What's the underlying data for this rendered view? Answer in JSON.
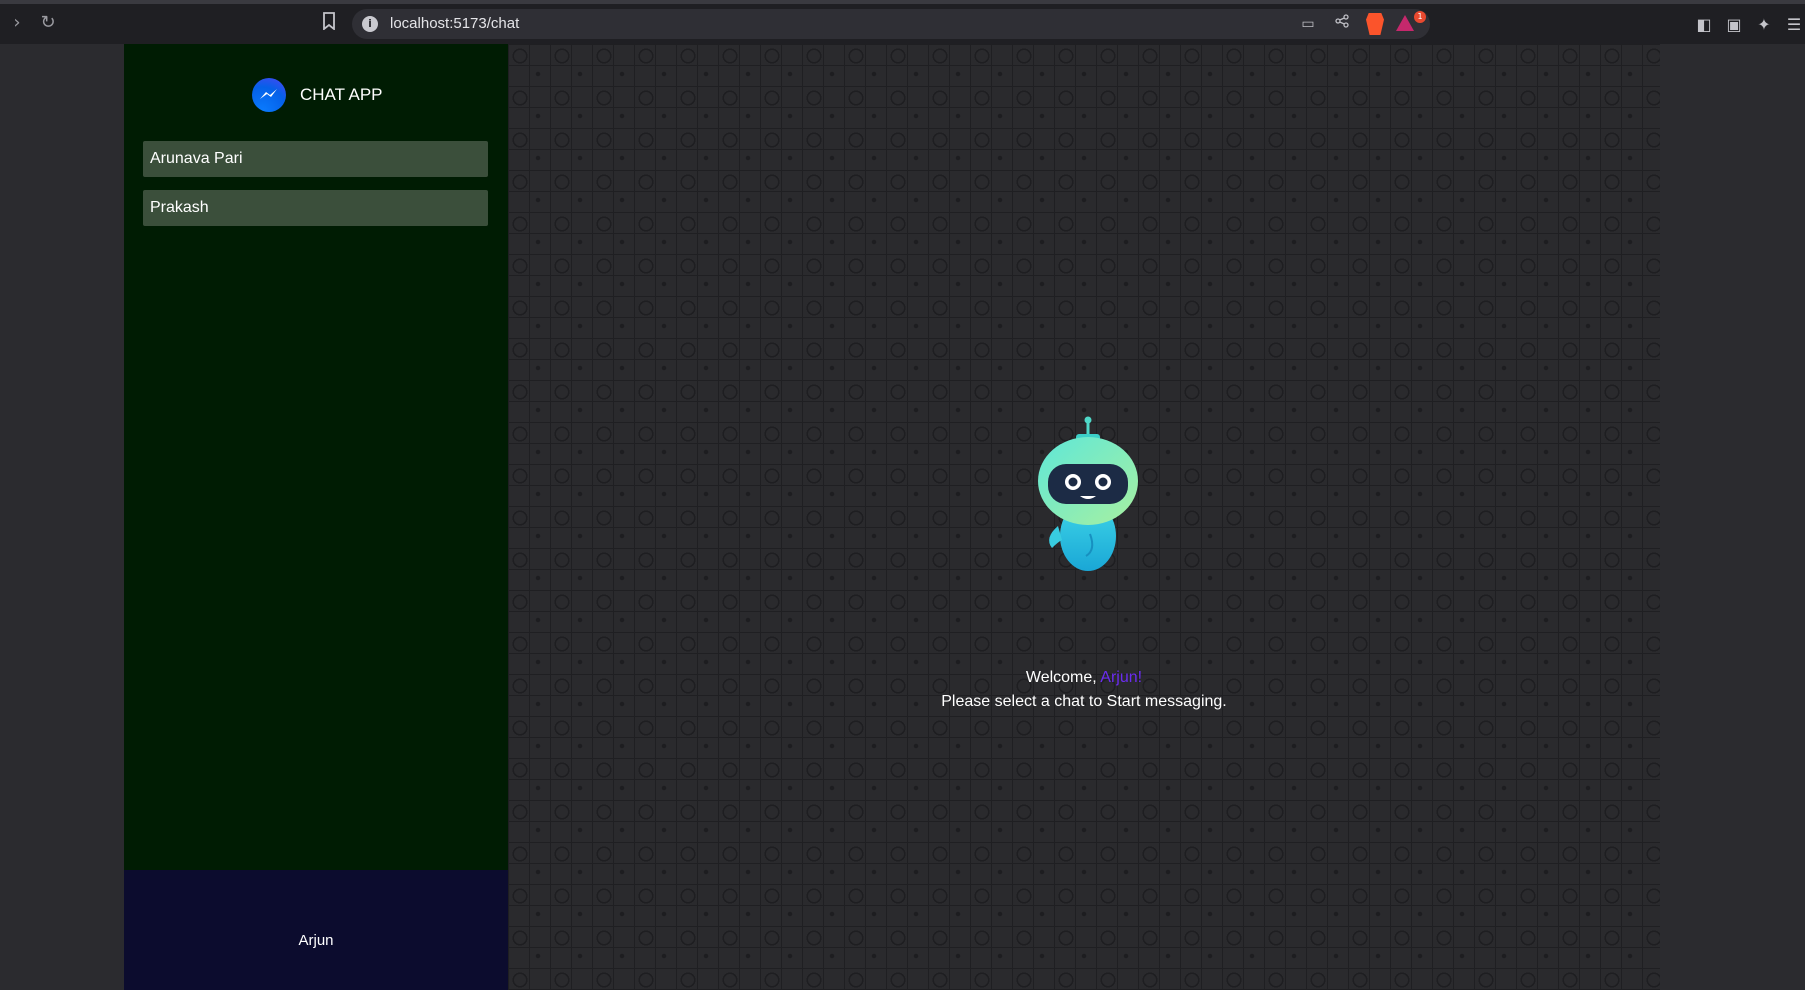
{
  "browser": {
    "url": "localhost:5173/chat",
    "rewards_badge": "1"
  },
  "sidebar": {
    "app_title": "CHAT APP",
    "chats": [
      {
        "name": "Arunava Pari"
      },
      {
        "name": "Prakash"
      }
    ],
    "current_user": "Arjun"
  },
  "main": {
    "welcome_prefix": "Welcome, ",
    "welcome_name": "Arjun!",
    "instruction": "Please select a chat to Start messaging."
  },
  "colors": {
    "sidebar_bg": "#001c03",
    "chat_item_bg": "#3b4f3b",
    "footer_bg": "#0c0c2e",
    "welcome_name_accent": "#6b2cf0"
  }
}
